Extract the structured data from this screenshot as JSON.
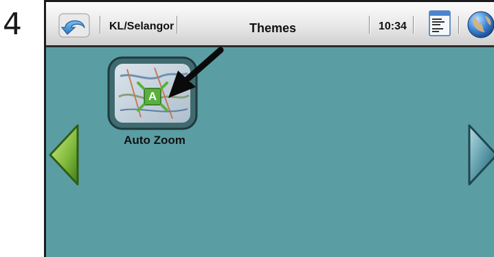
{
  "step_number": "4",
  "header": {
    "region": "KL/Selangor",
    "title": "Themes",
    "clock": "10:34"
  },
  "tiles": [
    {
      "label": "Auto Zoom",
      "badge": "A",
      "icon": "map-auto-zoom-icon"
    }
  ],
  "icons": {
    "back": "undo-arrow-icon",
    "menu": "menu-document-icon",
    "globe": "globe-icon",
    "nav_left": "left-arrow-icon",
    "nav_right": "right-arrow-icon",
    "pointer": "pointer-arrow-icon"
  },
  "colors": {
    "screen_background": "#5a9ea3",
    "header_gradient_top": "#fcfcfc",
    "nav_arrow_green": "#7fb83a",
    "nav_arrow_teal": "#4e8f9e",
    "tile_frame": "#3f6b70"
  }
}
